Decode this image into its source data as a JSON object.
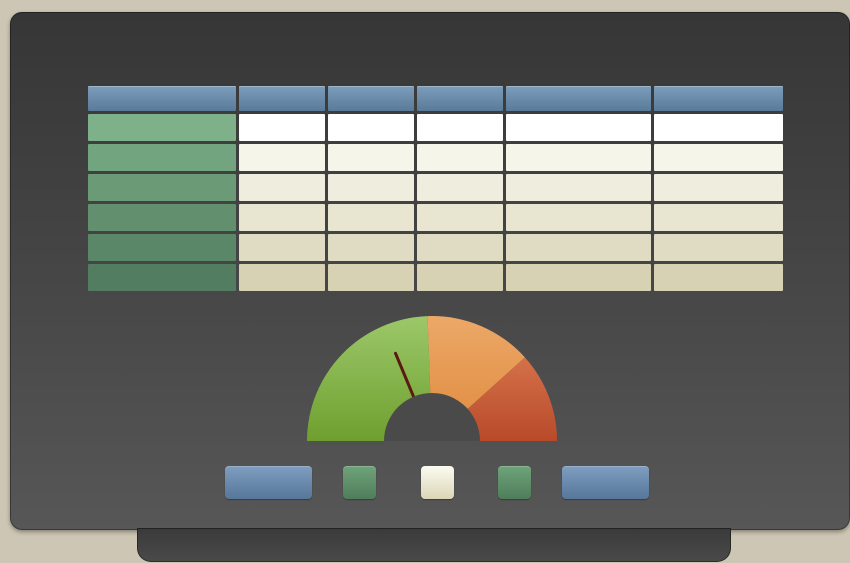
{
  "colors": {
    "header": "#6a8aab",
    "first_column": [
      "#7eb08a",
      "#72a57f",
      "#6a9a76",
      "#62906f",
      "#5a8768",
      "#527d60"
    ],
    "body_rows": [
      "#ffffff",
      "#f6f5ea",
      "#efedde",
      "#e8e5d0",
      "#e0dcc3",
      "#d8d2b5"
    ],
    "gauge_segments": [
      "#7dae3c",
      "#e89a52",
      "#c65a36"
    ],
    "needle": "#5a1a10"
  },
  "table": {
    "columns": 6,
    "rows": 6
  },
  "gauge": {
    "needle_value_fraction": 0.58
  },
  "controls": [
    {
      "name": "left-blue-button",
      "kind": "blue"
    },
    {
      "name": "left-green-button",
      "kind": "green"
    },
    {
      "name": "center-cream-button",
      "kind": "cream"
    },
    {
      "name": "right-green-button",
      "kind": "green"
    },
    {
      "name": "right-blue-button",
      "kind": "blue"
    }
  ]
}
